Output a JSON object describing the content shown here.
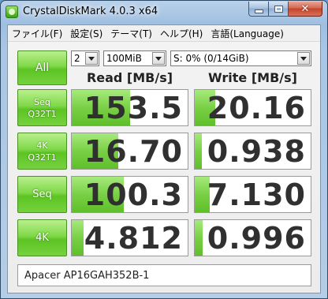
{
  "window": {
    "title": "CrystalDiskMark 4.0.3 x64"
  },
  "menu": [
    "ファイル(F)",
    "設定(S)",
    "テーマ(T)",
    "ヘルプ(H)",
    "言語(Language)"
  ],
  "controls": {
    "all_label": "All",
    "runs": "2",
    "size": "100MiB",
    "drive": "S: 0% (0/14GiB)"
  },
  "columns": {
    "read": "Read [MB/s]",
    "write": "Write [MB/s]"
  },
  "rows": [
    {
      "label1": "Seq",
      "label2": "Q32T1",
      "read": "153.5",
      "write": "20.16",
      "read_fill": 0.5,
      "write_fill": 0.18
    },
    {
      "label1": "4K",
      "label2": "Q32T1",
      "read": "16.70",
      "write": "0.938",
      "read_fill": 0.4,
      "write_fill": 0.06
    },
    {
      "label1": "Seq",
      "label2": "",
      "read": "100.3",
      "write": "7.130",
      "read_fill": 0.45,
      "write_fill": 0.13
    },
    {
      "label1": "4K",
      "label2": "",
      "read": "4.812",
      "write": "0.996",
      "read_fill": 0.1,
      "write_fill": 0.07
    }
  ],
  "model": "Apacer AP16GAH352B-1"
}
